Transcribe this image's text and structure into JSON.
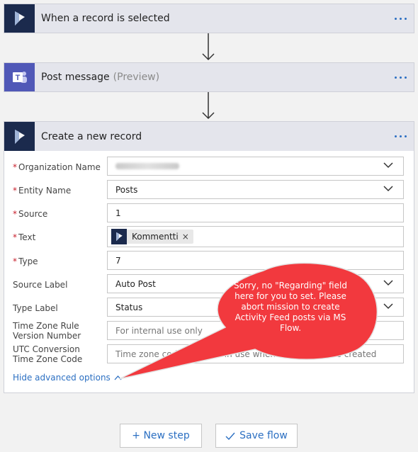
{
  "steps": [
    {
      "title": "When a record is selected",
      "subtitle": "",
      "icon": "dynamics-icon"
    },
    {
      "title": "Post message",
      "subtitle": "(Preview)",
      "icon": "teams-icon"
    },
    {
      "title": "Create a new record",
      "subtitle": "",
      "icon": "dynamics-icon"
    }
  ],
  "form": {
    "fields": [
      {
        "label": "Organization Name",
        "required": true,
        "value": "",
        "type": "dropdown",
        "redacted": true
      },
      {
        "label": "Entity Name",
        "required": true,
        "value": "Posts",
        "type": "dropdown"
      },
      {
        "label": "Source",
        "required": true,
        "value": "1",
        "type": "text"
      },
      {
        "label": "Text",
        "required": true,
        "token": "Kommentti",
        "token_remove": "×",
        "type": "token"
      },
      {
        "label": "Type",
        "required": true,
        "value": "7",
        "type": "text"
      },
      {
        "label": "Source Label",
        "required": false,
        "value": "Auto Post",
        "type": "dropdown"
      },
      {
        "label": "Type Label",
        "required": false,
        "value": "Status",
        "type": "dropdown"
      },
      {
        "label": "Time Zone Rule Version Number",
        "required": false,
        "placeholder": "For internal use only",
        "type": "text"
      },
      {
        "label": "UTC Conversion Time Zone Code",
        "required": false,
        "placeholder": "Time zone code that was in use when the record was created",
        "type": "text"
      }
    ],
    "required_marker": "*",
    "advanced_link": "Hide advanced options"
  },
  "callout": {
    "text": "Sorry, no \"Regarding\" field here for you to set. Please abort mission to create Activity Feed posts via MS Flow.",
    "color": "#f2393e"
  },
  "buttons": {
    "new_step": "+ New step",
    "save_flow": "Save flow"
  },
  "colors": {
    "accent": "#2b6fc2",
    "dynamics": "#1b2a4d",
    "teams": "#5058b7",
    "required": "#c8202c"
  }
}
